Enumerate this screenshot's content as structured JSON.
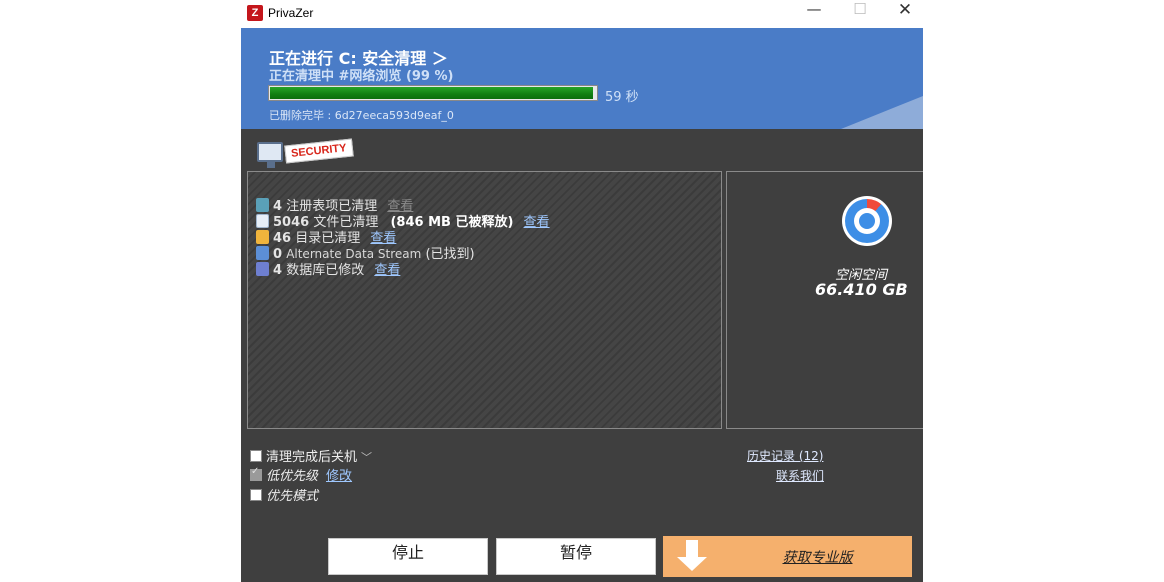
{
  "window": {
    "title": "PrivaZer",
    "icon_letter": "Z",
    "controls": {
      "minimize": "—",
      "maximize": "☐",
      "close": "✕"
    }
  },
  "header": {
    "title": "正在进行 C: 安全清理 ＞",
    "subtitle": "正在清理中 #网络浏览 (99 %)",
    "progress_percent": 99,
    "time_left": "59 秒",
    "deleted_label": "已删除完毕 : 6d27eeca593d9eaf_0"
  },
  "logo": {
    "text": "SECURITY"
  },
  "results": [
    {
      "icon": "registry-icon",
      "count": "4",
      "text": "注册表项已清理",
      "link": "查看",
      "link_enabled": false
    },
    {
      "icon": "file-icon",
      "count": "5046",
      "text": "文件已清理",
      "extra": "(846 MB 已被释放)",
      "link": "查看",
      "link_enabled": true
    },
    {
      "icon": "folder-icon",
      "count": "46",
      "text": "目录已清理",
      "link": "查看",
      "link_enabled": true
    },
    {
      "icon": "ads-icon",
      "count": "0",
      "text": "Alternate Data Stream",
      "extra": "(已找到)",
      "link": "",
      "link_enabled": false
    },
    {
      "icon": "database-icon",
      "count": "4",
      "text": "数据库已修改",
      "link": "查看",
      "link_enabled": true
    }
  ],
  "space": {
    "label": "空闲空间",
    "value": "66.410 GB"
  },
  "options": {
    "shutdown_label": "清理完成后关机",
    "shutdown_checked": false,
    "low_priority_label": "低优先级",
    "low_priority_checked": true,
    "low_priority_link": "修改",
    "priority_mode_label": "优先模式",
    "priority_mode_checked": false
  },
  "links": {
    "history": "历史记录 (12)",
    "contact": "联系我们"
  },
  "buttons": {
    "stop": "停止",
    "pause": "暂停",
    "get_pro": "获取专业版"
  },
  "colors": {
    "header_bg": "#4a7cc7",
    "main_bg": "#3f3f3f",
    "progress": "#117f11",
    "pro_button": "#f5b06d"
  }
}
